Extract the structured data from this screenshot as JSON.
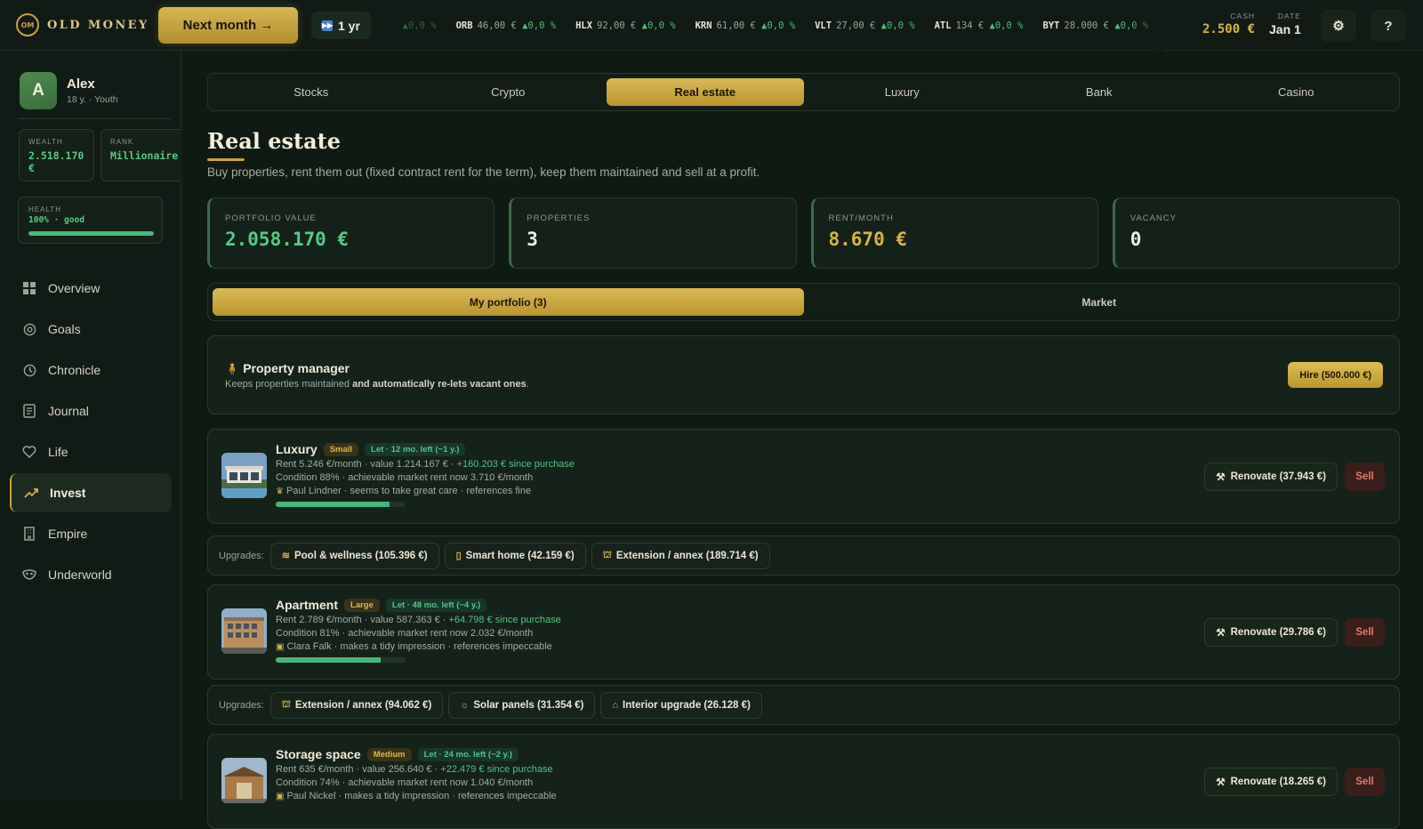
{
  "app": {
    "name": "OLD MONEY",
    "logo_text": "OM"
  },
  "topbar": {
    "next_month_label": "Next month →",
    "speed_label": "1 yr",
    "ticker": [
      {
        "symbol": "",
        "price": "€",
        "change": "▲0,0 %"
      },
      {
        "symbol": "ORB",
        "price": "46,00 €",
        "change": "▲0,0 %"
      },
      {
        "symbol": "HLX",
        "price": "92,00 €",
        "change": "▲0,0 %"
      },
      {
        "symbol": "KRN",
        "price": "61,00 €",
        "change": "▲0,0 %"
      },
      {
        "symbol": "VLT",
        "price": "27,00 €",
        "change": "▲0,0 %"
      },
      {
        "symbol": "ATL",
        "price": "134 €",
        "change": "▲0,0 %"
      },
      {
        "symbol": "BYT",
        "price": "28.000 €",
        "change": "▲0,0 %"
      }
    ],
    "cash_label": "CASH",
    "cash_value": "2.500 €",
    "date_label": "DATE",
    "date_value": "Jan 1",
    "settings_icon": "gear-icon",
    "help_label": "?"
  },
  "sidebar": {
    "avatar_letter": "A",
    "name": "Alex",
    "subtitle": "18 y. · Youth",
    "wealth_label": "WEALTH",
    "wealth_value": "2.518.170 €",
    "rank_label": "RANK",
    "rank_value": "Millionaire",
    "health_label": "HEALTH",
    "health_value": "100% · good",
    "health_percent": 100,
    "nav": [
      {
        "label": "Overview",
        "icon": "grid-icon"
      },
      {
        "label": "Goals",
        "icon": "target-icon"
      },
      {
        "label": "Chronicle",
        "icon": "clock-icon"
      },
      {
        "label": "Journal",
        "icon": "journal-icon"
      },
      {
        "label": "Life",
        "icon": "heart-icon"
      },
      {
        "label": "Invest",
        "icon": "trend-icon",
        "active": true
      },
      {
        "label": "Empire",
        "icon": "building-icon"
      },
      {
        "label": "Underworld",
        "icon": "mask-icon"
      }
    ]
  },
  "tabs": [
    "Stocks",
    "Crypto",
    "Real estate",
    "Luxury",
    "Bank",
    "Casino"
  ],
  "active_tab": "Real estate",
  "page": {
    "title": "Real estate",
    "subtitle": "Buy properties, rent them out (fixed contract rent for the term), keep them maintained and sell at a profit."
  },
  "kpis": [
    {
      "label": "PORTFOLIO VALUE",
      "value": "2.058.170 €",
      "color": "#59c986"
    },
    {
      "label": "PROPERTIES",
      "value": "3",
      "color": "#f1ecdb"
    },
    {
      "label": "RENT/MONTH",
      "value": "8.670 €",
      "color": "#d6b24a"
    },
    {
      "label": "VACANCY",
      "value": "0",
      "color": "#f1ecdb"
    }
  ],
  "subtabs": {
    "portfolio": "My portfolio (3)",
    "market": "Market"
  },
  "manager": {
    "title": "Property manager",
    "desc_plain": "Keeps properties maintained",
    "desc_bold": "and automatically re-lets vacant ones",
    "desc_end": ".",
    "hire_label": "Hire (500.000 €)"
  },
  "properties": [
    {
      "name": "Luxury",
      "size": "Small",
      "let": "Let · 12 mo. left (~1 y.)",
      "rent_value": "Rent 5.246 €/month · value 1.214.167 € · ",
      "gain": "+160.203 € since purchase",
      "condition": "Condition 88% · achievable market rent now 3.710 €/month",
      "tenant": "Paul Lindner · seems to take great care · references fine",
      "tenant_icon": "crown-icon",
      "condition_percent": 88,
      "renovate_label": "Renovate (37.943 €)",
      "sell_label": "Sell",
      "upgrades_label": "Upgrades:",
      "upgrades": [
        {
          "label": "Pool & wellness (105.396 €)",
          "icon": "waves-icon"
        },
        {
          "label": "Smart home (42.159 €)",
          "icon": "phone-icon"
        },
        {
          "label": "Extension / annex (189.714 €)",
          "icon": "crane-icon"
        }
      ]
    },
    {
      "name": "Apartment",
      "size": "Large",
      "let": "Let · 48 mo. left (~4 y.)",
      "rent_value": "Rent 2.789 €/month · value 587.363 € · ",
      "gain": "+64.798 € since purchase",
      "condition": "Condition 81% · achievable market rent now 2.032 €/month",
      "tenant": "Clara Falk · makes a tidy impression · references impeccable",
      "tenant_icon": "briefcase-icon",
      "condition_percent": 81,
      "renovate_label": "Renovate (29.786 €)",
      "sell_label": "Sell",
      "upgrades_label": "Upgrades:",
      "upgrades": [
        {
          "label": "Extension / annex (94.062 €)",
          "icon": "crane-icon"
        },
        {
          "label": "Solar panels (31.354 €)",
          "icon": "sun-icon"
        },
        {
          "label": "Interior upgrade (26.128 €)",
          "icon": "sofa-icon"
        }
      ]
    },
    {
      "name": "Storage space",
      "size": "Medium",
      "let": "Let · 24 mo. left (~2 y.)",
      "rent_value": "Rent 635 €/month · value 256.640 € · ",
      "gain": "+22.479 € since purchase",
      "condition": "Condition 74% · achievable market rent now 1.040 €/month",
      "tenant": "Paul Nickel · makes a tidy impression · references impeccable",
      "tenant_icon": "briefcase-icon",
      "condition_percent": 74,
      "renovate_label": "Renovate (18.265 €)",
      "sell_label": "Sell"
    }
  ]
}
